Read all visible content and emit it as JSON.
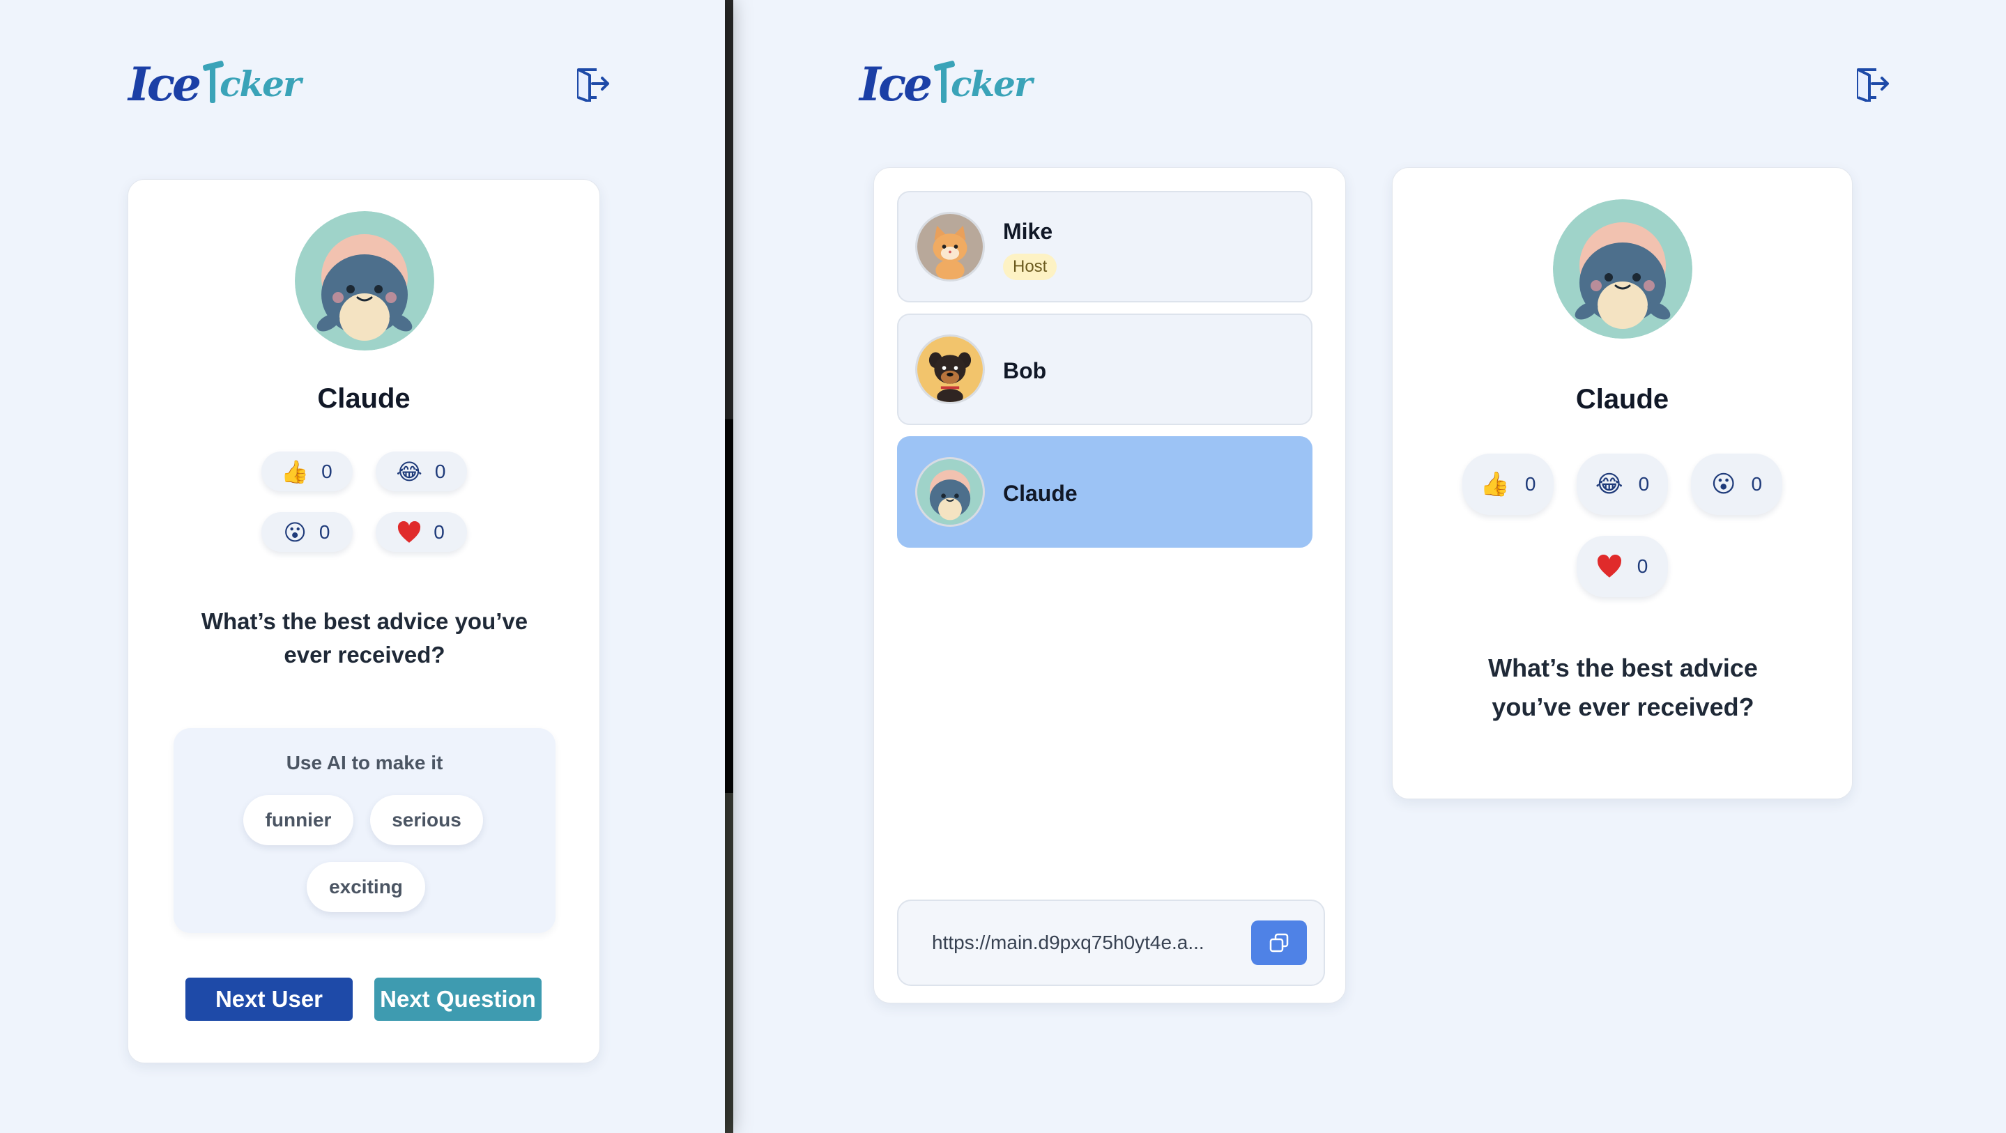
{
  "brand": {
    "logo_ice": "Ice",
    "logo_rest": "cker"
  },
  "colors": {
    "primary": "#1e4aa8",
    "teal": "#3e9bb0",
    "page_bg": "#eff4fc",
    "active_row": "#9cc3f5",
    "host_badge": "#fdf2c4"
  },
  "icons": {
    "logout": "logout-door-icon",
    "copy": "copy-icon"
  },
  "left": {
    "player": {
      "name": "Claude",
      "avatar": "whale-avatar"
    },
    "reactions": [
      {
        "emoji": "👍",
        "count": "0",
        "label": "thumbs-up"
      },
      {
        "emoji": "😂",
        "count": "0",
        "label": "laughing"
      },
      {
        "emoji": "😮",
        "count": "0",
        "label": "surprised"
      },
      {
        "emoji": "❤",
        "count": "0",
        "label": "heart"
      }
    ],
    "question": "What’s the best advice you’ve ever received?",
    "ai": {
      "title": "Use AI to make it",
      "options": [
        "funnier",
        "serious",
        "exciting"
      ]
    },
    "buttons": {
      "next_user": "Next User",
      "next_question": "Next Question"
    }
  },
  "right": {
    "users": [
      {
        "name": "Mike",
        "badge": "Host",
        "avatar": "cat-avatar",
        "active": false
      },
      {
        "name": "Bob",
        "badge": "",
        "avatar": "dog-avatar",
        "active": false
      },
      {
        "name": "Claude",
        "badge": "",
        "avatar": "whale-avatar",
        "active": true
      }
    ],
    "invite_url": "https://main.d9pxq75h0yt4e.a...",
    "player": {
      "name": "Claude",
      "avatar": "whale-avatar"
    },
    "reactions": [
      {
        "emoji": "👍",
        "count": "0",
        "label": "thumbs-up"
      },
      {
        "emoji": "😂",
        "count": "0",
        "label": "laughing"
      },
      {
        "emoji": "😮",
        "count": "0",
        "label": "surprised"
      },
      {
        "emoji": "❤",
        "count": "0",
        "label": "heart"
      }
    ],
    "question": "What’s the best advice you’ve ever received?"
  }
}
